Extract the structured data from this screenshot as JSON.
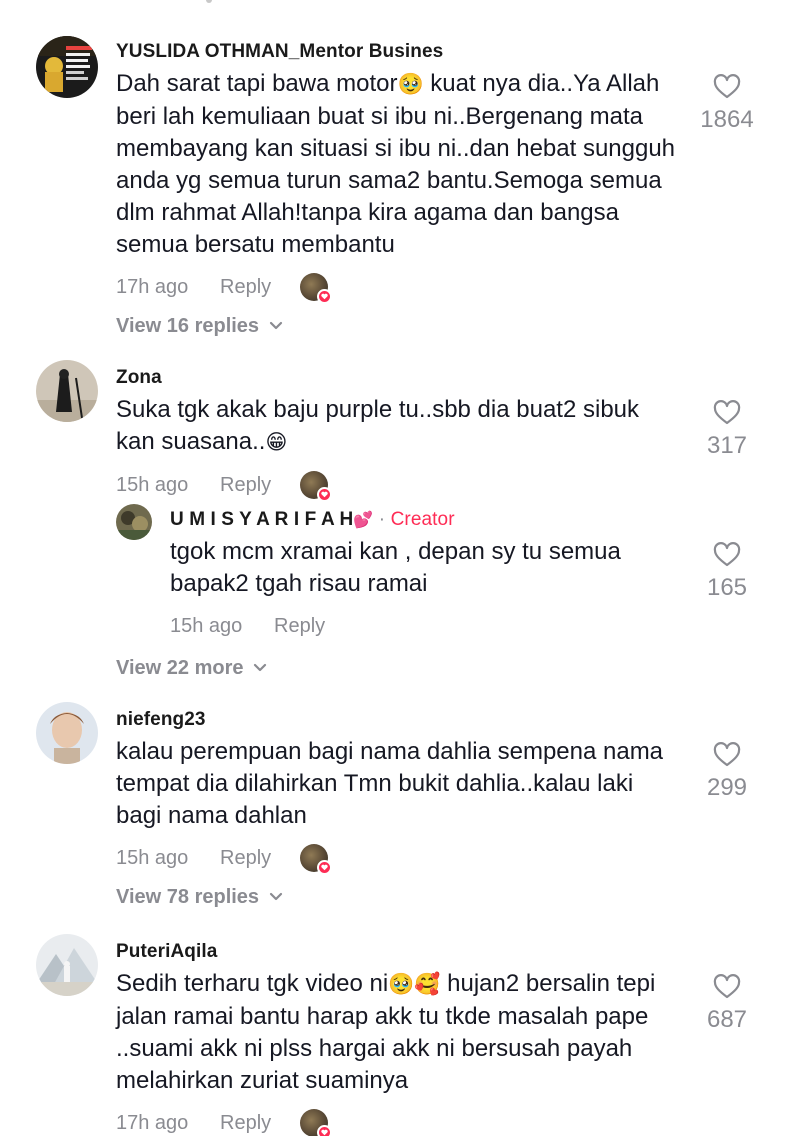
{
  "comments": [
    {
      "username": "YUSLIDA  OTHMAN_Mentor Busines",
      "text_part1": "Dah sarat tapi bawa motor",
      "emoji1": "🥹",
      "text_part2": " kuat nya dia..Ya Allah beri lah kemuliaan buat si ibu ni..Bergenang mata membayang kan situasi si ibu ni..dan hebat sungguh anda yg semua turun sama2 bantu.Semoga semua dlm rahmat Allah!tanpa kira agama dan bangsa semua bersatu membantu",
      "time": "17h ago",
      "reply_label": "Reply",
      "view_replies": "View 16 replies",
      "likes": "1864"
    },
    {
      "username": "Zona",
      "text_part1": "Suka tgk akak baju purple tu..sbb dia buat2 sibuk kan suasana..",
      "emoji1": "😁",
      "time": "15h ago",
      "reply_label": "Reply",
      "likes": "317",
      "reply": {
        "username": "U M I S Y A R I F A H",
        "username_emoji": "💕",
        "separator": "·",
        "creator_label": "Creator",
        "text": "tgok mcm xramai kan , depan sy tu semua bapak2 tgah risau ramai",
        "time": "15h ago",
        "reply_label": "Reply",
        "likes": "165"
      },
      "view_replies": "View 22 more"
    },
    {
      "username": "niefeng23",
      "text_part1": "kalau perempuan bagi nama dahlia sempena nama tempat dia dilahirkan Tmn bukit dahlia..kalau laki bagi nama dahlan",
      "time": "15h ago",
      "reply_label": "Reply",
      "view_replies": "View 78 replies",
      "likes": "299"
    },
    {
      "username": "PuteriAqila",
      "text_part1": "Sedih terharu tgk video ni",
      "emoji1": "🥹🥰",
      "text_part2": " hujan2 bersalin tepi jalan ramai bantu harap akk tu tkde masalah pape ..suami akk ni plss hargai akk ni bersusah payah melahirkan zuriat suaminya",
      "time": "17h ago",
      "reply_label": "Reply",
      "likes": "687"
    }
  ],
  "icons": {
    "like": "heart-outline-icon",
    "expand": "chevron-down-icon",
    "creator_liked": "heart-badge-icon"
  },
  "colors": {
    "accent": "#fe2c55",
    "muted": "#8a8b91",
    "text": "#161823"
  }
}
